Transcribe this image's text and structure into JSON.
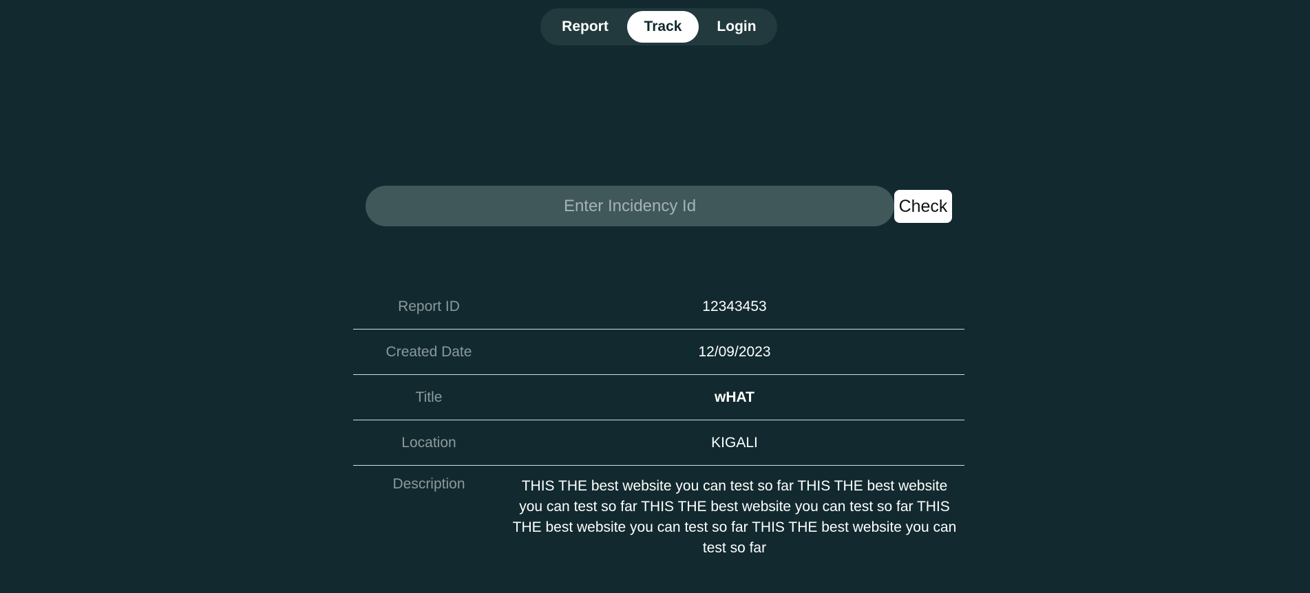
{
  "nav": {
    "items": [
      {
        "label": "Report",
        "active": false
      },
      {
        "label": "Track",
        "active": true
      },
      {
        "label": "Login",
        "active": false
      }
    ]
  },
  "search": {
    "placeholder": "Enter Incidency Id",
    "value": "",
    "button_label": "Check"
  },
  "report": {
    "rows": [
      {
        "label": "Report ID",
        "value": "12343453"
      },
      {
        "label": "Created Date",
        "value": "12/09/2023"
      },
      {
        "label": "Title",
        "value": "wHAT"
      },
      {
        "label": "Location",
        "value": "KIGALI"
      },
      {
        "label": "Description",
        "value": "THIS THE best website you can test so far THIS THE best website you can test so far THIS THE best website you can test so far THIS THE best website you can test so far THIS THE best website you can test so far"
      }
    ]
  },
  "colors": {
    "background": "#122a2f",
    "nav_background": "#22393d",
    "active_tab": "#ffffff",
    "input_background": "#40585a",
    "label_text": "#8b9a9c"
  }
}
